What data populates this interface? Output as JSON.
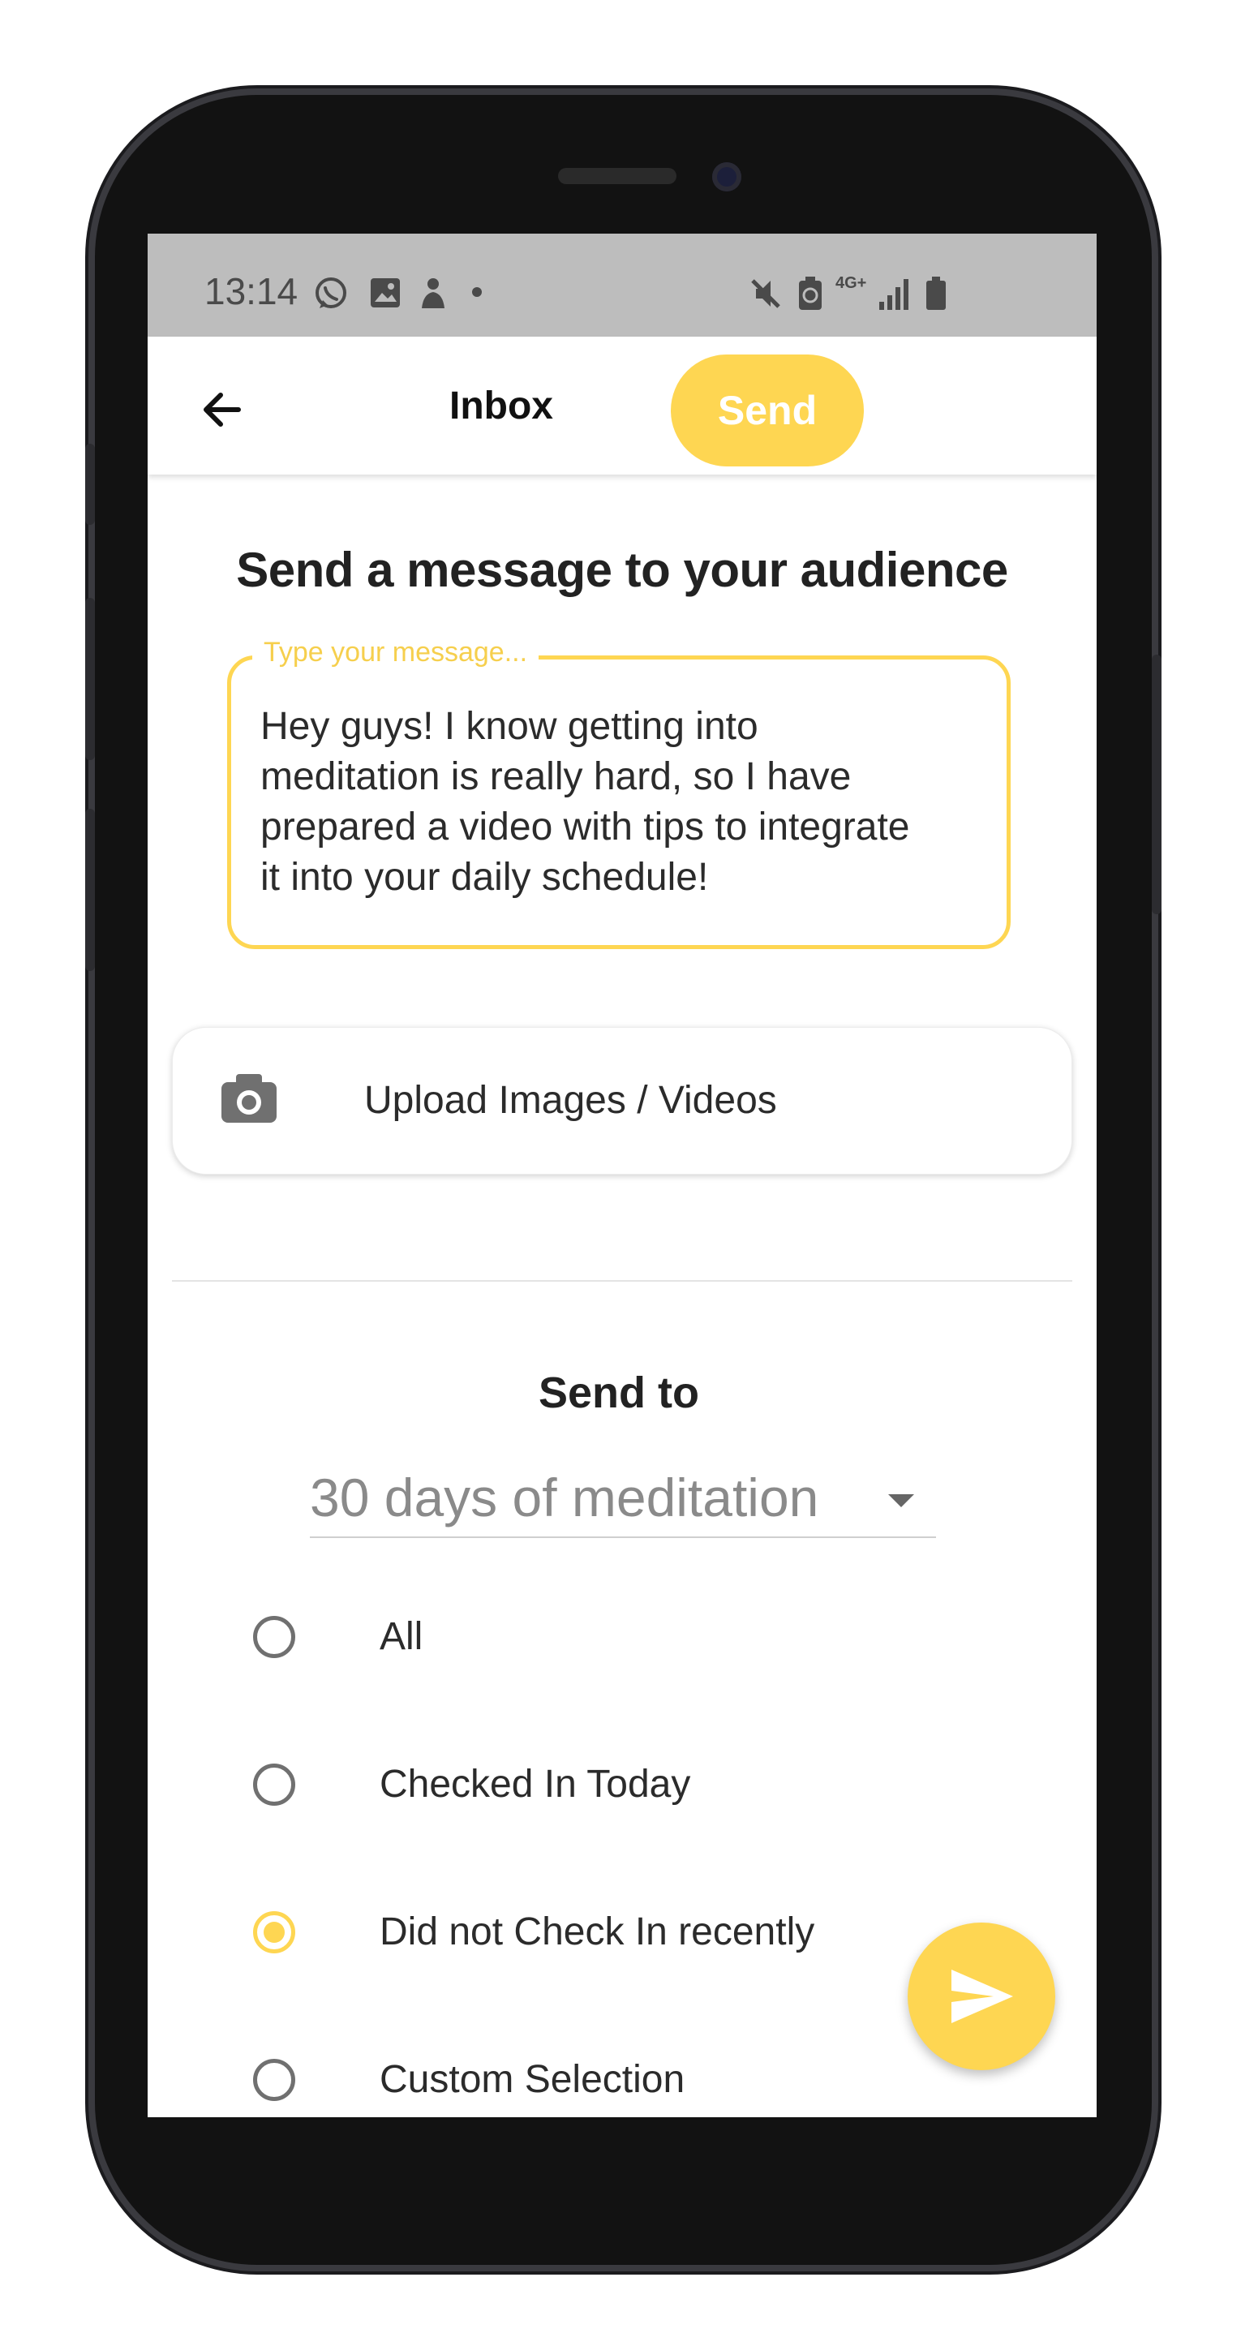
{
  "status_bar": {
    "time": "13:14",
    "network_label": "4G+",
    "icons": [
      "whatsapp-icon",
      "gallery-icon",
      "app-notification-icon",
      "dot-icon",
      "mute-icon",
      "battery-saver-icon",
      "network-4g-icon",
      "signal-icon",
      "battery-icon"
    ]
  },
  "appbar": {
    "back_icon": "arrow-left-icon",
    "title": "Inbox",
    "send_label": "Send"
  },
  "compose": {
    "heading": "Send a message to your audience",
    "message_label": "Type your message...",
    "message_value": "Hey guys! I know getting into\nmeditation is really hard, so I have\nprepared a video with tips to integrate\nit into your daily schedule!"
  },
  "upload": {
    "icon": "camera-icon",
    "label": "Upload Images / Videos"
  },
  "send_to": {
    "heading": "Send to",
    "selected_program": "30 days of meditation",
    "options": [
      {
        "label": "All",
        "checked": false
      },
      {
        "label": "Checked In Today",
        "checked": false
      },
      {
        "label": "Did not Check In recently",
        "checked": true
      },
      {
        "label": "Custom Selection",
        "checked": false
      }
    ]
  },
  "fab": {
    "icon": "send-icon"
  },
  "colors": {
    "accent": "#fed652",
    "status_bar": "#bdbdbd",
    "text": "#222222"
  }
}
